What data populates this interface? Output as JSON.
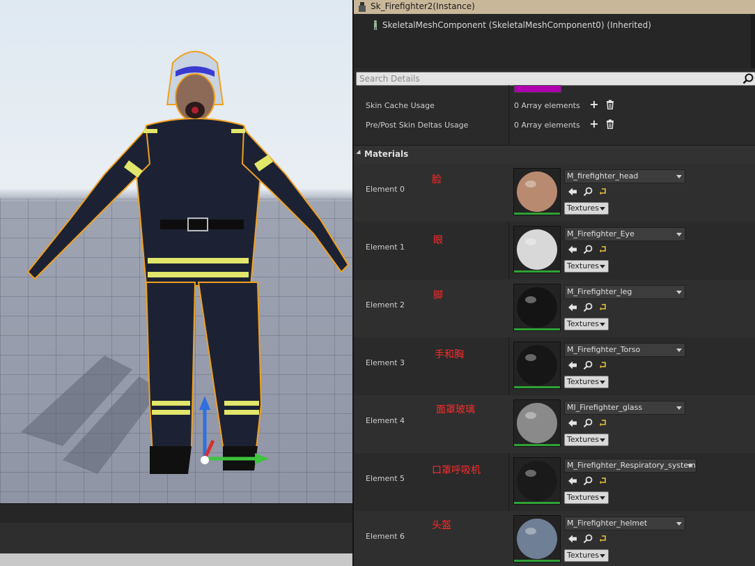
{
  "instance": {
    "title": "Sk_Firefighter2(Instance)"
  },
  "component": {
    "label": "SkeletalMeshComponent (SkeletalMeshComponent0) (Inherited)"
  },
  "search": {
    "placeholder": "Search Details"
  },
  "properties": [
    {
      "name": "Skin Cache Usage",
      "value": "0 Array elements"
    },
    {
      "name": "Pre/Post Skin Deltas Usage",
      "value": "0 Array elements"
    }
  ],
  "materials": {
    "title": "Materials",
    "texture_button": "Textures",
    "elements": [
      {
        "label": "Element 0",
        "note": "脸",
        "material": "M_firefighter_head"
      },
      {
        "label": "Element 1",
        "note": "眼",
        "material": "M_Firefighter_Eye"
      },
      {
        "label": "Element 2",
        "note": "脚",
        "material": "M_Firefighter_leg"
      },
      {
        "label": "Element 3",
        "note": "手和胸",
        "material": "M_Firefighter_Torso"
      },
      {
        "label": "Element 4",
        "note": "面罩玻璃",
        "material": "MI_Firefighter_glass"
      },
      {
        "label": "Element 5",
        "note": "口罩呼吸机",
        "material": "M_Firefighter_Respiratory_system"
      },
      {
        "label": "Element 6",
        "note": "头盔",
        "material": "M_Firefighter_helmet"
      }
    ]
  },
  "colors": {
    "annotation": "#ff2a2a",
    "selection_outline": "#f0a020",
    "instance_bar": "#c9b79a",
    "thumbnail_status": "#2fa336"
  },
  "icons": {
    "browse": "arrow-left-icon",
    "find": "magnifier-icon",
    "reset": "reset-arrow-icon",
    "add": "plus-icon",
    "delete": "trash-icon"
  }
}
